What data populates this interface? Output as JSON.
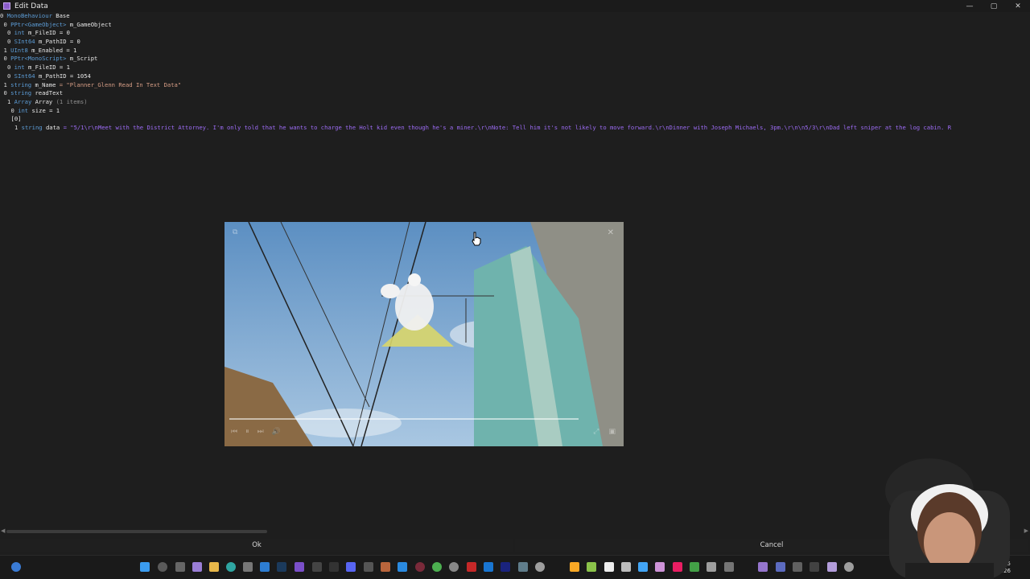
{
  "window": {
    "title": "Edit Data"
  },
  "window_controls": {
    "minimize": "—",
    "maximize": "▢",
    "close": "✕"
  },
  "tree": [
    {
      "indent": 0,
      "num": "0",
      "type": "MonoBehaviour",
      "name": "Base",
      "value": ""
    },
    {
      "indent": 1,
      "num": "0",
      "type": "PPtr<GameObject>",
      "name": "m_GameObject",
      "value": ""
    },
    {
      "indent": 2,
      "num": "0",
      "type": "int",
      "name": "m_FileID",
      "value": "= 0"
    },
    {
      "indent": 2,
      "num": "0",
      "type": "SInt64",
      "name": "m_PathID",
      "value": "= 0"
    },
    {
      "indent": 1,
      "num": "1",
      "type": "UInt8",
      "name": "m_Enabled",
      "value": "= 1"
    },
    {
      "indent": 1,
      "num": "0",
      "type": "PPtr<MonoScript>",
      "name": "m_Script",
      "value": ""
    },
    {
      "indent": 2,
      "num": "0",
      "type": "int",
      "name": "m_FileID",
      "value": "= 1"
    },
    {
      "indent": 2,
      "num": "0",
      "type": "SInt64",
      "name": "m_PathID",
      "value": "= 1054"
    },
    {
      "indent": 1,
      "num": "1",
      "type": "string",
      "name": "m_Name",
      "value": "= \"Planner_Glenn Read In Text Data\""
    },
    {
      "indent": 1,
      "num": "0",
      "type": "string",
      "name": "readText",
      "value": ""
    },
    {
      "indent": 2,
      "num": "1",
      "type": "Array",
      "name": "Array",
      "value": "(1 items)"
    },
    {
      "indent": 3,
      "num": "0",
      "type": "int",
      "name": "size",
      "value": "= 1"
    },
    {
      "indent": 3,
      "num": "",
      "type": "",
      "name": "[0]",
      "value": ""
    },
    {
      "indent": 4,
      "num": "1",
      "type": "string",
      "name": "data",
      "value": "= \"5/1\\r\\nMeet with the District Attorney. I'm only told that he wants to charge the Holt kid even though he's a miner.\\r\\nNote: Tell him it's not likely to move forward.\\r\\nDinner with Joseph Michaels, 3pm.\\r\\n\\n5/3\\r\\nDad left sniper at the log cabin. R"
    }
  ],
  "player": {
    "close": "✕",
    "pip": "⧉",
    "controls": [
      "⏮",
      "⏸",
      "⏭",
      "🔊"
    ],
    "right": [
      "⤢",
      "▣"
    ]
  },
  "buttons": {
    "ok": "Ok",
    "cancel": "Cancel"
  },
  "scroll_arrows": {
    "left": "◀",
    "right": "▶"
  },
  "clock": {
    "time": "01:35",
    "date": "2026"
  },
  "colors": {
    "accent": "#9d6cf5",
    "type": "#5c9cd6",
    "background": "#1e1e1e"
  }
}
